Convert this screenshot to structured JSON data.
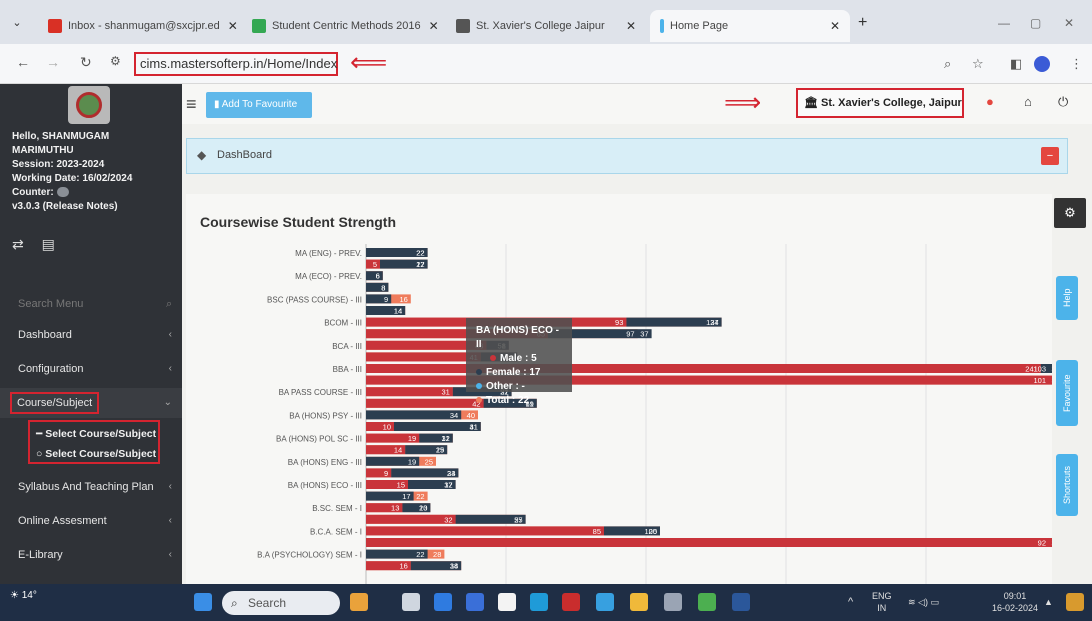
{
  "browser": {
    "tabs": [
      {
        "label": "Inbox - shanmugam@sxcjpr.ed",
        "color": "#d93025",
        "active": false
      },
      {
        "label": "Student Centric Methods 2016",
        "color": "#34a853",
        "active": false
      },
      {
        "label": "St. Xavier's College Jaipur",
        "color": "#555555",
        "active": false
      },
      {
        "label": "Home Page",
        "color": "#4cb3ea",
        "active": true
      }
    ],
    "url": "cims.mastersofterp.in/Home/Index"
  },
  "topnav": {
    "favourite_label": "Add To Favourite",
    "college": "St. Xavier's College, Jaipur"
  },
  "sidebar": {
    "greeting": "Hello, SHANMUGAM",
    "surname": "MARIMUTHU",
    "session": "Session: 2023-2024",
    "working_date": "Working Date: 16/02/2024",
    "counter": "Counter:",
    "version": "v3.0.3 (Release Notes)",
    "search_placeholder": "Search Menu",
    "items": [
      {
        "label": "Dashboard"
      },
      {
        "label": "Configuration"
      },
      {
        "label": "Course/Subject"
      },
      {
        "label": "Syllabus And Teaching Plan"
      },
      {
        "label": "Online Assesment"
      },
      {
        "label": "E-Library"
      }
    ],
    "subitems": [
      {
        "label": "Select Course/Subject"
      },
      {
        "label": "Select Course/Subject"
      }
    ]
  },
  "dashboard": {
    "breadcrumb": "DashBoard"
  },
  "side_tabs": [
    "Help",
    "Favourite",
    "Shortcuts"
  ],
  "tooltip": {
    "title": "BA (HONS) ECO - II",
    "male": "Male : 5",
    "female": "Female : 17",
    "other": "Other : -",
    "total": "Total : 22"
  },
  "taskbar": {
    "search_label": "Search",
    "weather": "14°",
    "lang_top": "ENG",
    "lang_bottom": "IN",
    "time": "09:01",
    "date": "16-02-2024"
  },
  "colors": {
    "male": "#c9343a",
    "female": "#2c3e50",
    "other": "#4cb3ea",
    "total": "#ef7c5c"
  },
  "chart_data": {
    "type": "bar",
    "title": "Coursewise Student Strength",
    "orientation": "horizontal",
    "stacked": true,
    "series_names": [
      "Male",
      "Female",
      "Other",
      "Total"
    ],
    "xlim": [
      0,
      250
    ],
    "rows": [
      {
        "label": "MA (ENG) - PREV.",
        "bars": [
          [
            0,
            22,
            22
          ]
        ]
      },
      {
        "label": "",
        "bars": [
          [
            5,
            17,
            22
          ]
        ]
      },
      {
        "label": "MA (ECO) - PREV.",
        "bars": [
          [
            0,
            6,
            6
          ]
        ]
      },
      {
        "label": "",
        "bars": [
          [
            0,
            8,
            8
          ]
        ]
      },
      {
        "label": "BSC (PASS COURSE) - III",
        "bars": [
          [
            0,
            9,
            16
          ]
        ]
      },
      {
        "label": "",
        "bars": [
          [
            0,
            14,
            14
          ]
        ]
      },
      {
        "label": "BCOM - III",
        "bars": [
          [
            93,
            34,
            127
          ]
        ]
      },
      {
        "label": "",
        "bars": [
          [
            65,
            37,
            97
          ]
        ]
      },
      {
        "label": "BCA - III",
        "bars": [
          [
            43,
            8,
            51
          ]
        ]
      },
      {
        "label": "",
        "bars": [
          [
            41,
            13,
            54
          ]
        ]
      },
      {
        "label": "BBA - III",
        "bars": [
          [
            241,
            103,
            344
          ]
        ]
      },
      {
        "label": "",
        "bars": [
          [
            264,
            101,
            365
          ]
        ]
      },
      {
        "label": "BA PASS COURSE - III",
        "bars": [
          [
            31,
            21,
            52
          ]
        ]
      },
      {
        "label": "",
        "bars": [
          [
            42,
            19,
            61
          ]
        ]
      },
      {
        "label": "BA (HONS) PSY - III",
        "bars": [
          [
            0,
            34,
            40
          ]
        ]
      },
      {
        "label": "",
        "bars": [
          [
            10,
            31,
            41
          ]
        ]
      },
      {
        "label": "BA (HONS) POL SC - III",
        "bars": [
          [
            19,
            12,
            31
          ]
        ]
      },
      {
        "label": "",
        "bars": [
          [
            14,
            15,
            29
          ]
        ]
      },
      {
        "label": "BA (HONS) ENG - III",
        "bars": [
          [
            0,
            19,
            25
          ]
        ]
      },
      {
        "label": "",
        "bars": [
          [
            9,
            24,
            33
          ]
        ]
      },
      {
        "label": "BA (HONS) ECO - III",
        "bars": [
          [
            15,
            17,
            32
          ]
        ]
      },
      {
        "label": "",
        "bars": [
          [
            0,
            17,
            22
          ]
        ]
      },
      {
        "label": "B.SC. SEM - I",
        "bars": [
          [
            13,
            10,
            23
          ]
        ]
      },
      {
        "label": "",
        "bars": [
          [
            32,
            25,
            57
          ]
        ]
      },
      {
        "label": "B.C.A. SEM - I",
        "bars": [
          [
            85,
            20,
            105
          ]
        ]
      },
      {
        "label": "",
        "bars": [
          [
            293,
            92,
            385
          ]
        ]
      },
      {
        "label": "B.A (PSYCHOLOGY) SEM - I",
        "bars": [
          [
            0,
            22,
            28
          ]
        ]
      },
      {
        "label": "",
        "bars": [
          [
            16,
            18,
            34
          ]
        ]
      }
    ]
  }
}
